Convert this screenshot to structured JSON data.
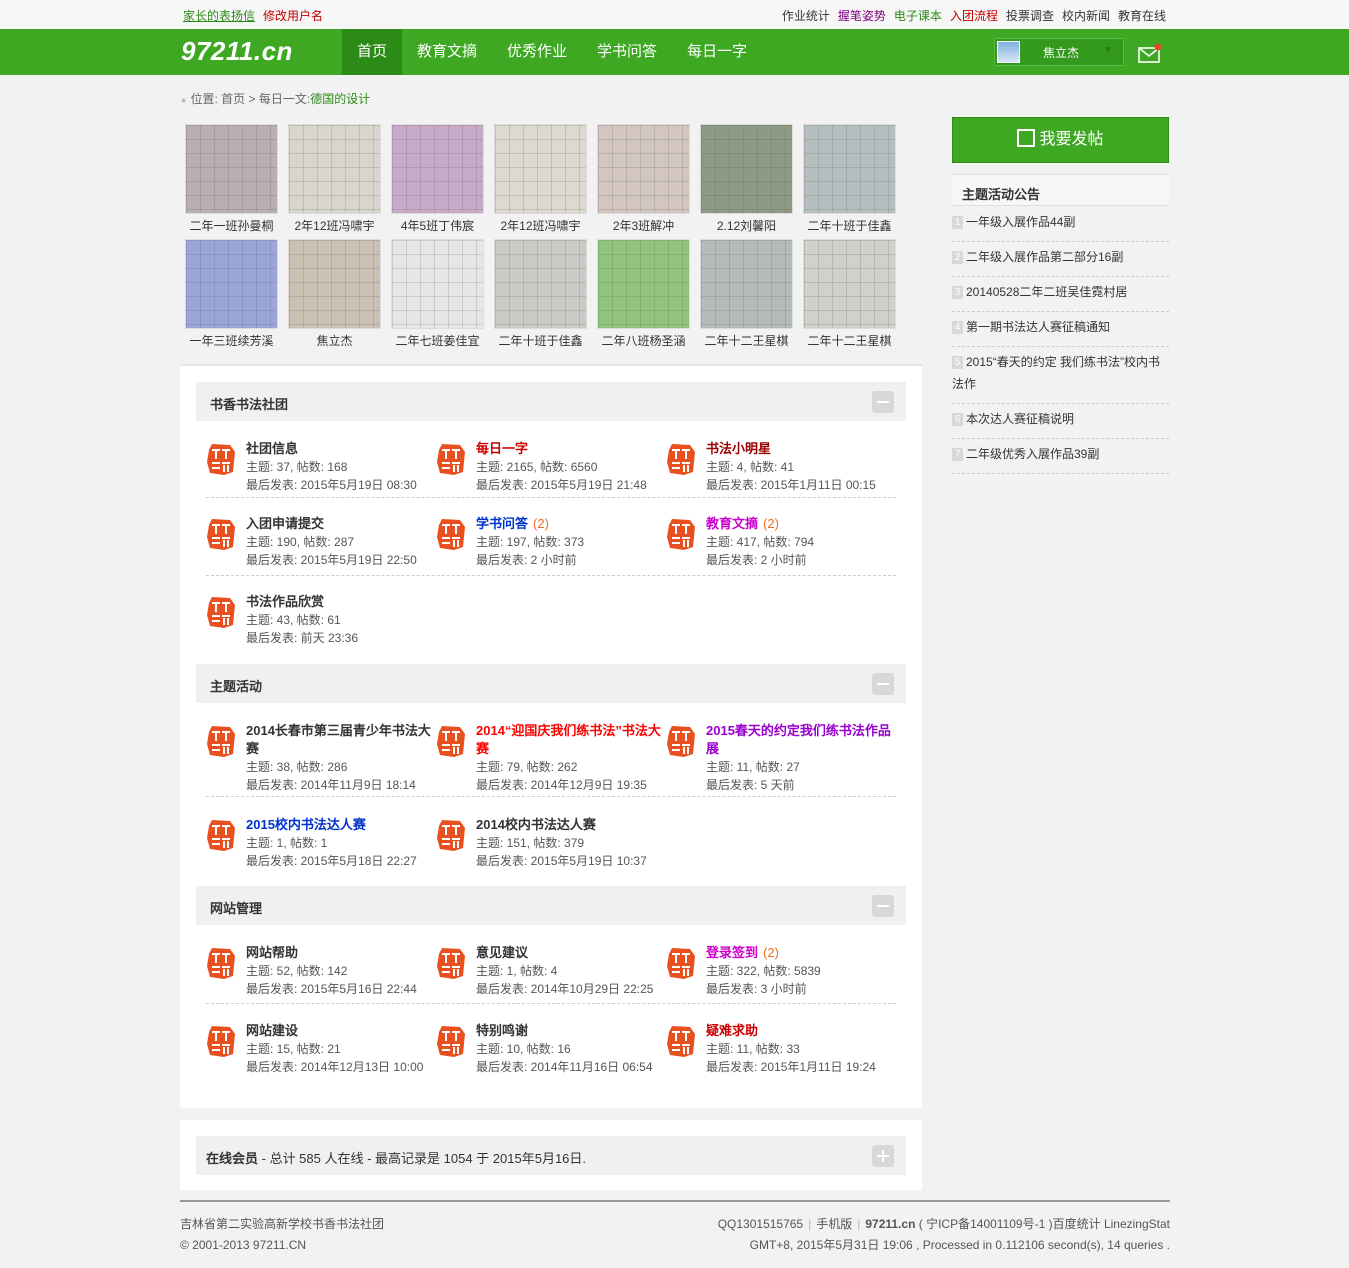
{
  "topbar": {
    "left": [
      {
        "label": "家长的表扬信",
        "color": "#2c8a16"
      },
      {
        "label": "修改用户名",
        "color": "#c00000"
      }
    ],
    "right": [
      {
        "label": "作业统计",
        "color": "#333333"
      },
      {
        "label": "握笔姿势",
        "color": "#800080"
      },
      {
        "label": "电子课本",
        "color": "#2c8a16"
      },
      {
        "label": "入团流程",
        "color": "#c00000"
      },
      {
        "label": "投票调查",
        "color": "#333333"
      },
      {
        "label": "校内新闻",
        "color": "#333333"
      },
      {
        "label": "教育在线",
        "color": "#333333"
      }
    ]
  },
  "header": {
    "logo": "97211.cn",
    "nav": [
      "首页",
      "教育文摘",
      "优秀作业",
      "学书问答",
      "每日一字"
    ],
    "active_nav": 0,
    "user": "焦立杰",
    "accent": "#3ea823"
  },
  "breadcrumb": {
    "prefix": "位置:",
    "home": "首页",
    "sep": ">",
    "section": "每日一文",
    "current": "德国的设计"
  },
  "thumbnails": [
    {
      "caption": "二年一班孙曼桐",
      "tone": "#b9aeb4"
    },
    {
      "caption": "2年12班冯啸宇",
      "tone": "#d8d6cc"
    },
    {
      "caption": "4年5班丁伟宸",
      "tone": "#c7aac8"
    },
    {
      "caption": "2年12班冯啸宇",
      "tone": "#ddd9cf"
    },
    {
      "caption": "2年3班解冲",
      "tone": "#d2c6bf"
    },
    {
      "caption": "2.12刘馨阳",
      "tone": "#8e9a84"
    },
    {
      "caption": "二年十班于佳鑫",
      "tone": "#b6bfbf"
    },
    {
      "caption": "一年三班续芳溪",
      "tone": "#9aa6da"
    },
    {
      "caption": "焦立杰",
      "tone": "#cbc0b4"
    },
    {
      "caption": "二年七班姜佳宜",
      "tone": "#e6e6e6"
    },
    {
      "caption": "二年十班于佳鑫",
      "tone": "#c9ccc6"
    },
    {
      "caption": "二年八班杨圣涵",
      "tone": "#8fc47a"
    },
    {
      "caption": "二年十二王星棋",
      "tone": "#b6bcbc"
    },
    {
      "caption": "二年十二王星棋",
      "tone": "#d2d0cc"
    }
  ],
  "sections": [
    {
      "title": "书香书法社团",
      "forums": [
        {
          "name": "社团信息",
          "color": "#333333",
          "new": "",
          "stats": "主题: 37, 帖数: 168",
          "last": "最后发表: 2015年5月19日 08:30"
        },
        {
          "name": "每日一字",
          "color": "#cc0000",
          "new": "",
          "stats": "主题: 2165, 帖数: 6560",
          "last": "最后发表: 2015年5月19日 21:48"
        },
        {
          "name": "书法小明星",
          "color": "#990000",
          "new": "",
          "stats": "主题: 4, 帖数: 41",
          "last": "最后发表: 2015年1月11日 00:15"
        },
        {
          "name": "入团申请提交",
          "color": "#333333",
          "new": "",
          "stats": "主题: 190, 帖数: 287",
          "last": "最后发表: 2015年5月19日 22:50"
        },
        {
          "name": "学书问答",
          "color": "#0033cc",
          "new": "(2)",
          "stats": "主题: 197, 帖数: 373",
          "last": "最后发表: 2 小时前"
        },
        {
          "name": "教育文摘",
          "color": "#cc00cc",
          "new": "(2)",
          "stats": "主题: 417, 帖数: 794",
          "last": "最后发表: 2 小时前"
        },
        {
          "name": "书法作品欣赏",
          "color": "#333333",
          "new": "",
          "stats": "主题: 43, 帖数: 61",
          "last": "最后发表: 前天 23:36"
        }
      ]
    },
    {
      "title": "主题活动",
      "forums": [
        {
          "name": "2014长春市第三届青少年书法大赛",
          "color": "#333333",
          "new": "",
          "stats": "主题: 38, 帖数: 286",
          "last": "最后发表: 2014年11月9日 18:14"
        },
        {
          "name": "2014“迎国庆我们练书法”书法大赛",
          "color": "#ff0000",
          "new": "",
          "stats": "主题: 79, 帖数: 262",
          "last": "最后发表: 2014年12月9日 19:35"
        },
        {
          "name": "2015春天的约定我们练书法作品展",
          "color": "#9900cc",
          "new": "",
          "stats": "主题: 11, 帖数: 27",
          "last": "最后发表: 5 天前"
        },
        {
          "name": "2015校内书法达人赛",
          "color": "#0033cc",
          "new": "",
          "stats": "主题: 1, 帖数: 1",
          "last": "最后发表: 2015年5月18日 22:27"
        },
        {
          "name": "2014校内书法达人赛",
          "color": "#333333",
          "new": "",
          "stats": "主题: 151, 帖数: 379",
          "last": "最后发表: 2015年5月19日 10:37"
        }
      ]
    },
    {
      "title": "网站管理",
      "forums": [
        {
          "name": "网站帮助",
          "color": "#333333",
          "new": "",
          "stats": "主题: 52, 帖数: 142",
          "last": "最后发表: 2015年5月16日 22:44"
        },
        {
          "name": "意见建议",
          "color": "#333333",
          "new": "",
          "stats": "主题: 1, 帖数: 4",
          "last": "最后发表: 2014年10月29日 22:25"
        },
        {
          "name": "登录签到",
          "color": "#cc00cc",
          "new": "(2)",
          "stats": "主题: 322, 帖数: 5839",
          "last": "最后发表: 3 小时前"
        },
        {
          "name": "网站建设",
          "color": "#333333",
          "new": "",
          "stats": "主题: 15, 帖数: 21",
          "last": "最后发表: 2014年12月13日 10:00"
        },
        {
          "name": "特别鸣谢",
          "color": "#333333",
          "new": "",
          "stats": "主题: 10, 帖数: 16",
          "last": "最后发表: 2014年11月16日 06:54"
        },
        {
          "name": "疑难求助",
          "color": "#cc0000",
          "new": "",
          "stats": "主题: 11, 帖数: 33",
          "last": "最后发表: 2015年1月11日 19:24"
        }
      ]
    }
  ],
  "online": {
    "label": "在线会员",
    "text": " - 总计 585 人在线 - 最高记录是 1054 于 2015年5月16日."
  },
  "sidebar": {
    "post_button": "我要发帖",
    "notice_title": "主题活动公告",
    "notices": [
      "一年级入展作品44副",
      "二年级入展作品第二部分16副",
      "20140528二年二班吴佳霓村居",
      "第一期书法达人赛征稿通知",
      "2015“春天的约定 我们练书法”校内书法作",
      "本次达人赛征稿说明",
      "二年级优秀入展作品39副"
    ]
  },
  "footer": {
    "left1": "吉林省第二实验高新学校书香书法社团",
    "left2": "© 2001-2013 97211.CN",
    "qq": "QQ1301515765",
    "mobile": "手机版",
    "site": "97211.cn",
    "icp": "( 宁ICP备14001109号-1 )",
    "stat": "百度统计 LinezingStat",
    "right2": "GMT+8, 2015年5月31日 19:06 , Processed in 0.112106 second(s), 14 queries ."
  }
}
